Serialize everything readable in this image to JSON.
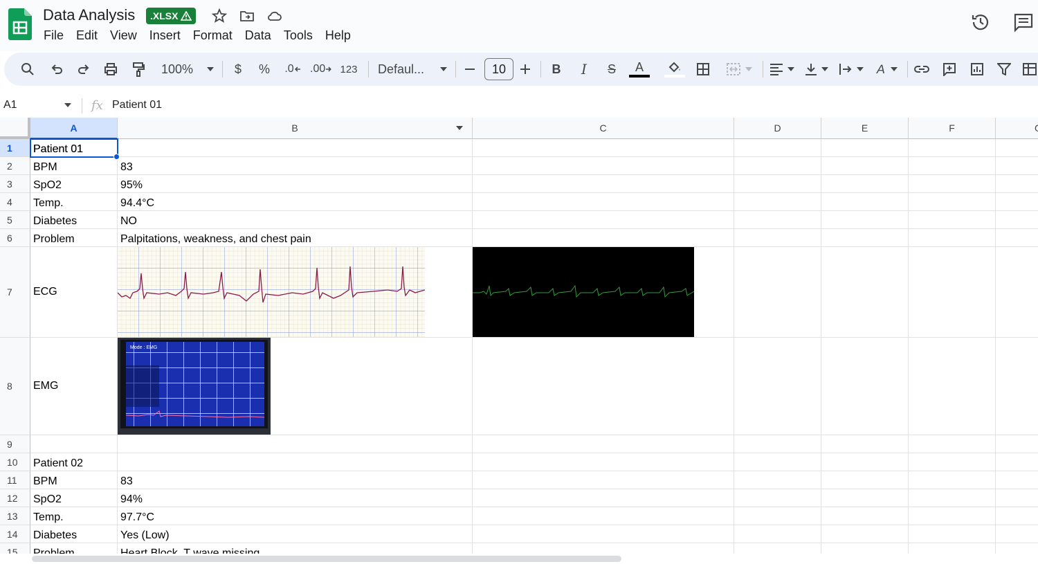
{
  "app": {
    "doc_title": "Data Analysis",
    "badge": ".XLSX",
    "menu": [
      "File",
      "Edit",
      "View",
      "Insert",
      "Format",
      "Data",
      "Tools",
      "Help"
    ]
  },
  "toolbar": {
    "zoom": "100%",
    "currency": "$",
    "percent": "%",
    "dec_decrease": ".0",
    "dec_increase": ".00",
    "number_format": "123",
    "font": "Defaul...",
    "font_size": "10",
    "text_color": "#000000"
  },
  "formula_bar": {
    "name_box": "A1",
    "fx": "fx",
    "content": "Patient 01"
  },
  "columns": [
    "A",
    "B",
    "C",
    "D",
    "E",
    "F",
    "G"
  ],
  "rows": {
    "r1": {
      "num": "1",
      "a": "Patient 01",
      "b": ""
    },
    "r2": {
      "num": "2",
      "a": "BPM",
      "b": "83"
    },
    "r3": {
      "num": "3",
      "a": "SpO2",
      "b": "95%"
    },
    "r4": {
      "num": "4",
      "a": "Temp.",
      "b": "94.4°C"
    },
    "r5": {
      "num": "5",
      "a": "Diabetes",
      "b": "NO"
    },
    "r6": {
      "num": "6",
      "a": "Problem",
      "b": "Palpitations, weakness, and chest pain"
    },
    "r7": {
      "num": "7",
      "a": "ECG",
      "b": ""
    },
    "r8": {
      "num": "8",
      "a": "EMG",
      "b": ""
    },
    "r9": {
      "num": "9",
      "a": "",
      "b": ""
    },
    "r10": {
      "num": "10",
      "a": "Patient 02",
      "b": ""
    },
    "r11": {
      "num": "11",
      "a": "BPM",
      "b": "83"
    },
    "r12": {
      "num": "12",
      "a": "SpO2",
      "b": "94%"
    },
    "r13": {
      "num": "13",
      "a": "Temp.",
      "b": "97.7°C"
    },
    "r14": {
      "num": "14",
      "a": "Diabetes",
      "b": "Yes (Low)"
    },
    "r15": {
      "num": "15",
      "a": "Problem",
      "b": "Heart Block, T wave missing"
    }
  },
  "images": {
    "emg_screen_label": "Mode : EMG"
  },
  "colors": {
    "accent": "#0b57d0",
    "brand_green": "#188038",
    "ecg_trace": "#8b1a4a",
    "ecg_dark_trace": "#2e9e3a",
    "emg_screen": "#1a2fb0"
  }
}
